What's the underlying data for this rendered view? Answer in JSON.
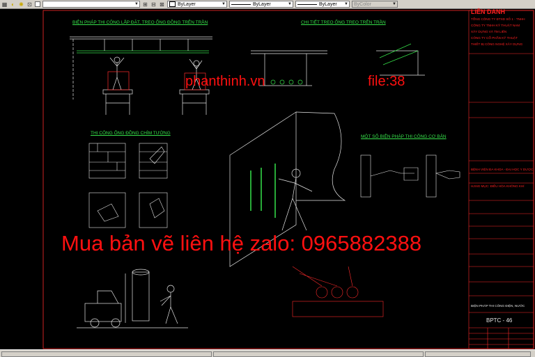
{
  "toolbar": {
    "icons": [
      "layer-icon",
      "bulb-icon",
      "sun-icon",
      "lock-icon",
      "color-icon",
      "layer-props-icon",
      "match-icon",
      "previous-icon"
    ],
    "color_combo": "ByLayer",
    "linetype_combo": "ByLayer",
    "lineweight_combo": "ByLayer",
    "plotstyle_combo": "ByColor"
  },
  "drawing": {
    "section_install": "BIỆN PHÁP THI CÔNG LẮP ĐẶT, TREO ỐNG ĐỒNG TRÊN TRẦN",
    "section_detail": "CHI TIẾT TREO ỐNG TREO TRÊN TRẦN",
    "section_concealed": "THI CÔNG ỐNG ĐỒNG CHÌM TƯỜNG",
    "section_basic": "MỘT SỐ BIỆN PHÁP THI CÔNG CƠ BẢN"
  },
  "title_block": {
    "company_header": "LIÊN DANH",
    "company_lines": [
      "TỔNG CÔNG TY ĐTXD SỐ 1 - TNHH",
      "CÔNG TY TNHH KỸ THUẬT NAM",
      "XÂY DỰNG VÀ TM LIÊN",
      "CÔNG TY CỔ PHẦN KỸ THUẬT",
      "THIẾT BỊ CÔNG NGHỆ XÂY DỰNG"
    ],
    "project_name": "BỆNH VIỆN ĐA KHOA - ĐẠI HỌC Y DƯỢC",
    "item_name": "HẠNG MỤC: ĐIỀU HÒA KHÔNG KHÍ",
    "sheet_title": "BIỆN PHÁP THI CÔNG ĐIỆN, NƯỚC",
    "sheet_number": "BPTC - 46"
  },
  "watermark": {
    "site": "phanthinh.vn",
    "file": "file:38",
    "contact": "Mua bản vẽ liên hệ zalo: 0965882388"
  }
}
